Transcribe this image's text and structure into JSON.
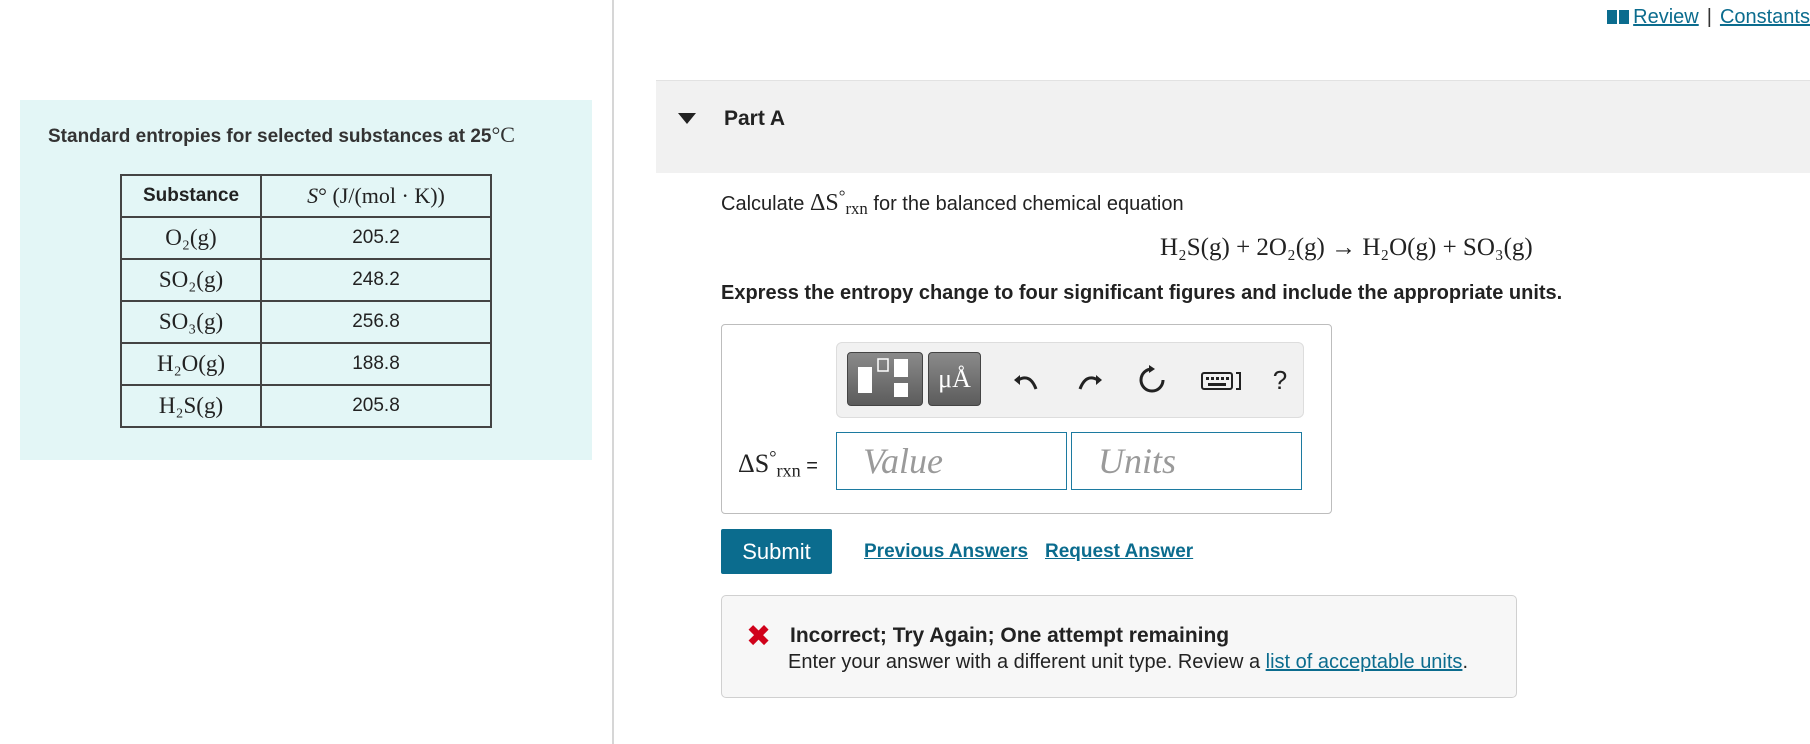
{
  "header": {
    "review_link": "Review",
    "separator": "|",
    "constants_link": "Constants"
  },
  "left": {
    "title": "Standard entropies for selected substances at 25",
    "title_unit": "°C",
    "table": {
      "col1_header": "Substance",
      "col2_header": {
        "symbol": "S",
        "degree": "°",
        "units": " (J/(mol · K))"
      },
      "rows": [
        {
          "substance": "O₂(g)",
          "value": "205.2"
        },
        {
          "substance": "SO₂(g)",
          "value": "248.2"
        },
        {
          "substance": "SO₃(g)",
          "value": "256.8"
        },
        {
          "substance": "H₂O(g)",
          "value": "188.8"
        },
        {
          "substance": "H₂S(g)",
          "value": "205.8"
        }
      ]
    }
  },
  "part": {
    "title": "Part A"
  },
  "question": {
    "prefix": "Calculate",
    "delta_s": "ΔS",
    "degree": "°",
    "rxn": "rxn",
    "suffix": " for the balanced chemical equation",
    "equation": "H₂S(g) + 2O₂(g) → H₂O(g) + SO₃(g)",
    "instruction": "Express the entropy change to four significant figures and include the appropriate units."
  },
  "answer": {
    "units_button": "μÅ",
    "help": "?",
    "label_equals": " =",
    "value_placeholder": "Value",
    "units_placeholder": "Units"
  },
  "actions": {
    "submit": "Submit",
    "previous_answers": "Previous Answers",
    "request_answer": "Request Answer"
  },
  "feedback": {
    "title": "Incorrect; Try Again; One attempt remaining",
    "message": "Enter your answer with a different unit type. Review a ",
    "link": "list of acceptable units",
    "end": "."
  },
  "colors": {
    "accent": "#0b6c8e",
    "panel_bg": "#e3f6f6",
    "error": "#d0021b"
  }
}
